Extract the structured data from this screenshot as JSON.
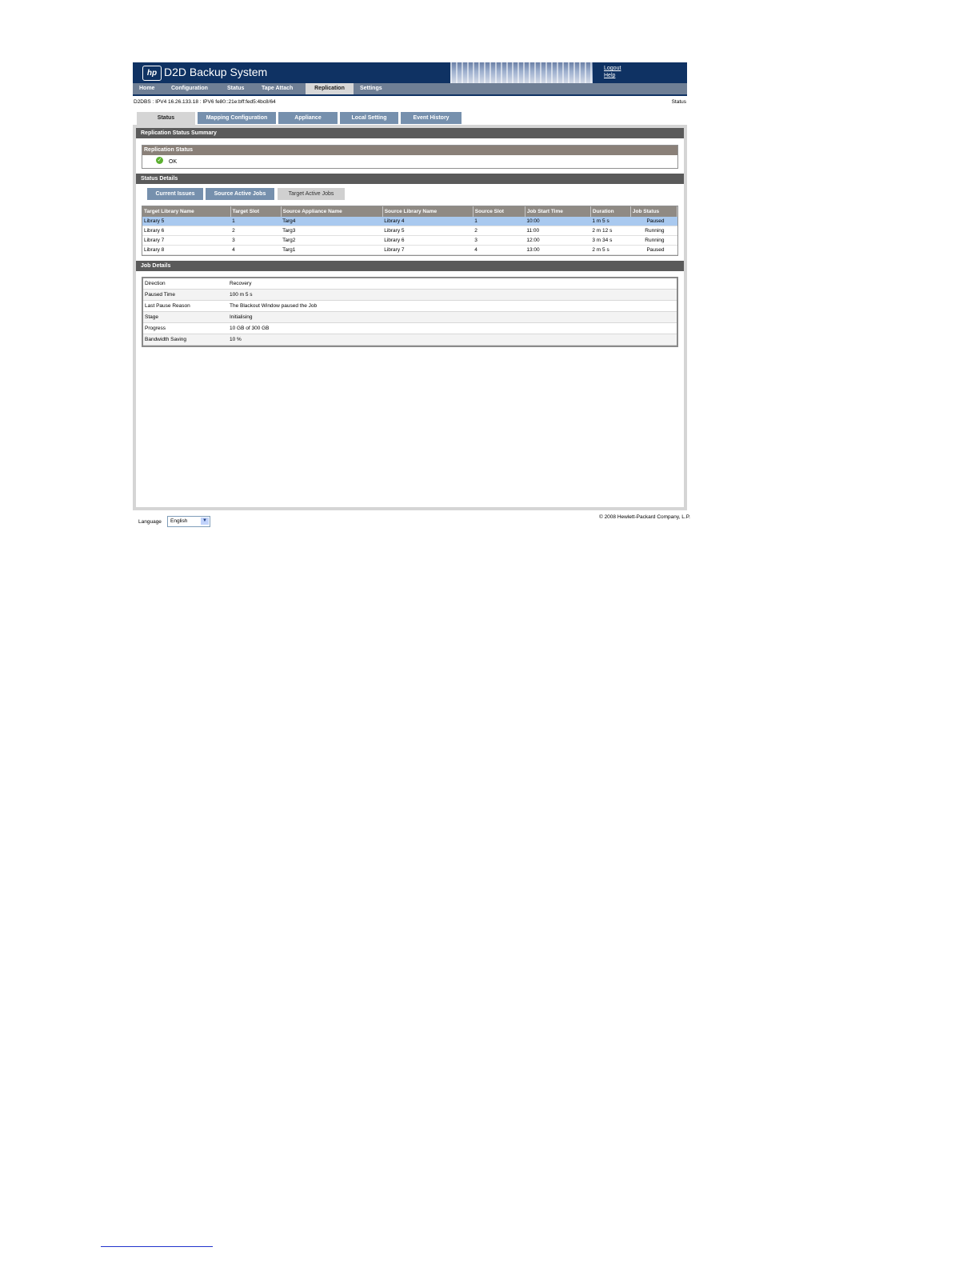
{
  "header": {
    "logo_text": "hp",
    "title": "D2D Backup System",
    "links": [
      "Logout",
      "Help"
    ]
  },
  "nav": {
    "items": [
      "Home",
      "Configuration",
      "Status",
      "Tape Attach",
      "Replication",
      "Settings"
    ],
    "active": "Replication"
  },
  "infobar": {
    "address": "D2DBS : IPV4 16.26.133.18 : IPV6 fe80::21e:bff:fed5:4bc8/64",
    "status_link": "Status"
  },
  "page_tabs": {
    "items": [
      "Status",
      "Mapping Configuration",
      "Appliance",
      "Local Setting",
      "Event History"
    ],
    "active": "Status"
  },
  "summary": {
    "section_title": "Replication Status Summary",
    "box_title": "Replication Status",
    "status_value": "OK"
  },
  "status_details": {
    "section_title": "Status Details",
    "sub_tabs": [
      "Current Issues",
      "Source Active Jobs",
      "Target Active Jobs"
    ],
    "active_sub_tab": "Target Active Jobs",
    "columns": [
      "Target Library Name",
      "Target Slot",
      "Source Appliance Name",
      "Source Library Name",
      "Source Slot",
      "Job Start Time",
      "Duration",
      "Job Status"
    ],
    "rows": [
      [
        "Library 5",
        "1",
        "Targ4",
        "Library 4",
        "1",
        "10:00",
        "1 m 5 s",
        "Paused"
      ],
      [
        "Library 6",
        "2",
        "Targ3",
        "Library 5",
        "2",
        "11:00",
        "2 m 12 s",
        "Running"
      ],
      [
        "Library 7",
        "3",
        "Targ2",
        "Library 6",
        "3",
        "12:00",
        "3 m 34 s",
        "Running"
      ],
      [
        "Library 8",
        "4",
        "Targ1",
        "Library 7",
        "4",
        "13:00",
        "2 m 5 s",
        "Paused"
      ]
    ],
    "selected_row": 0
  },
  "job_details": {
    "section_title": "Job Details",
    "rows": [
      [
        "Direction",
        "Recovery"
      ],
      [
        "Paused Time",
        "100 m 5 s"
      ],
      [
        "Last Pause Reason",
        "The Blackout Window paused the Job"
      ],
      [
        "Stage",
        "Initialising"
      ],
      [
        "Progress",
        "10 GB of 300 GB"
      ],
      [
        "Bandwidth Saving",
        "10 %"
      ]
    ]
  },
  "footer": {
    "language_label": "Language",
    "language_value": "English",
    "copyright": "© 2008 Hewlett-Packard Company, L.P."
  },
  "colors": {
    "header_bg": "#0f3263",
    "nav_bg": "#6f7f95",
    "tab_bg": "#7690ad",
    "section_bar": "#5a5a5a",
    "selected_row": "#a9c9ef",
    "ok_green": "#5cb030"
  }
}
